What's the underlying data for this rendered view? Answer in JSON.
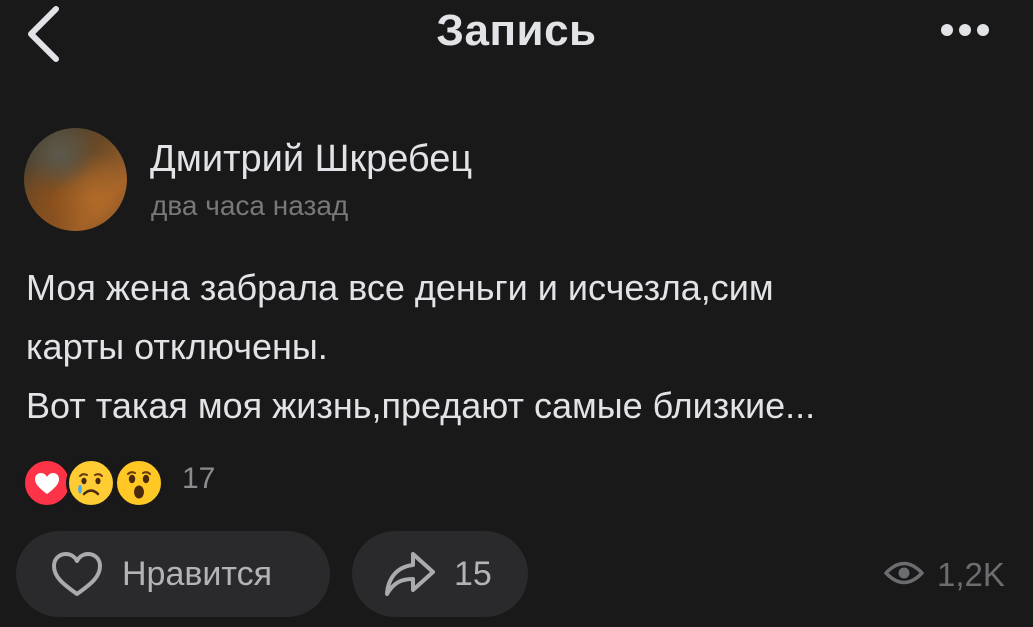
{
  "header": {
    "title": "Запись",
    "back_icon": "chevron-left-icon",
    "more_icon": "more-horizontal-icon"
  },
  "post": {
    "author_name": "Дмитрий Шкребец",
    "time": "два часа назад",
    "text_lines": [
      "Моя жена забрала все деньги и исчезла,сим",
      "карты отключены.",
      "Вот такая моя жизнь,предают самые близкие..."
    ]
  },
  "reactions": {
    "items": [
      "heart-reaction-icon",
      "crying-reaction-icon",
      "surprised-reaction-icon"
    ],
    "count": "17"
  },
  "actions": {
    "like_label": "Нравится",
    "share_count": "15",
    "views_count": "1,2K"
  },
  "colors": {
    "background": "#19191a",
    "text": "#e1e3e6",
    "secondary_text": "#76787a",
    "button_bg": "#2a2a2c",
    "heart": "#ff3347",
    "emoji_yellow": "#ffcc33"
  }
}
